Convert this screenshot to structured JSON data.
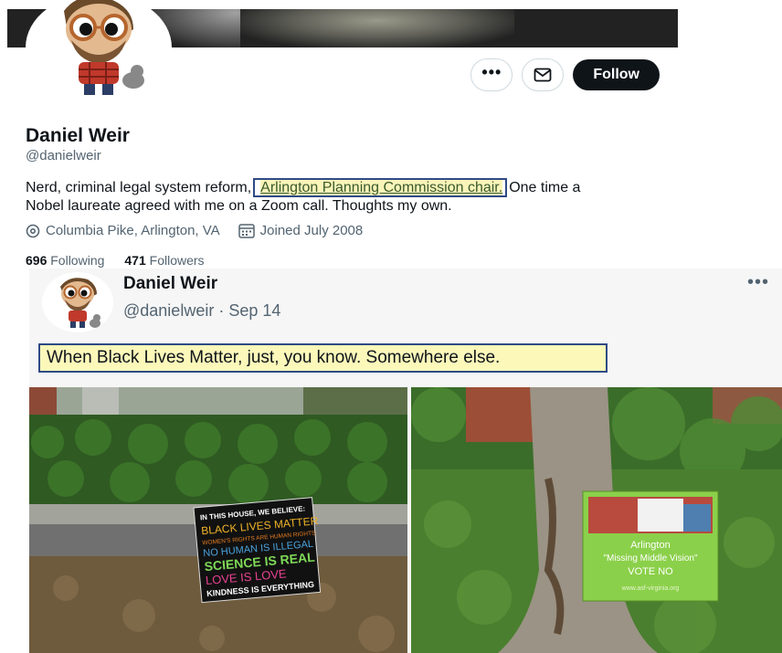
{
  "profile": {
    "name": "Daniel Weir",
    "handle": "@danielweir",
    "bio_part1": "Nerd, criminal legal system reform,",
    "bio_link": "Arlington Planning Commission chair.",
    "bio_part2": "One time a",
    "bio_line2": "Nobel laureate agreed with me on a Zoom call. Thoughts my own.",
    "location": "Columbia Pike, Arlington, VA",
    "joined": "Joined July 2008",
    "following_count": "696",
    "following_label": "Following",
    "followers_count": "471",
    "followers_label": "Followers",
    "follow_label": "Follow",
    "more_label": "•••"
  },
  "tweet": {
    "name": "Daniel Weir",
    "handle_date": "@danielweir · Sep 14",
    "more_label": "•••",
    "text": "When Black Lives Matter, just, you know. Somewhere else."
  },
  "sign_left": {
    "line1": "IN THIS HOUSE, WE BELIEVE:",
    "line2": "BLACK LIVES MATTER",
    "line3": "WOMEN'S RIGHTS ARE HUMAN RIGHTS",
    "line4": "NO HUMAN IS ILLEGAL",
    "line5": "SCIENCE IS REAL",
    "line6": "LOVE IS LOVE",
    "line7": "KINDNESS IS EVERYTHING"
  },
  "sign_right": {
    "line1": "Arlington",
    "line2": "\"Missing Middle Vision\"",
    "line3": "VOTE NO",
    "line4": "www.asf-virginia.org"
  },
  "colors": {
    "link_border": "#2f4a85",
    "highlight": "#fbf8ba",
    "follow_bg": "#0f1419",
    "muted": "#536471"
  }
}
